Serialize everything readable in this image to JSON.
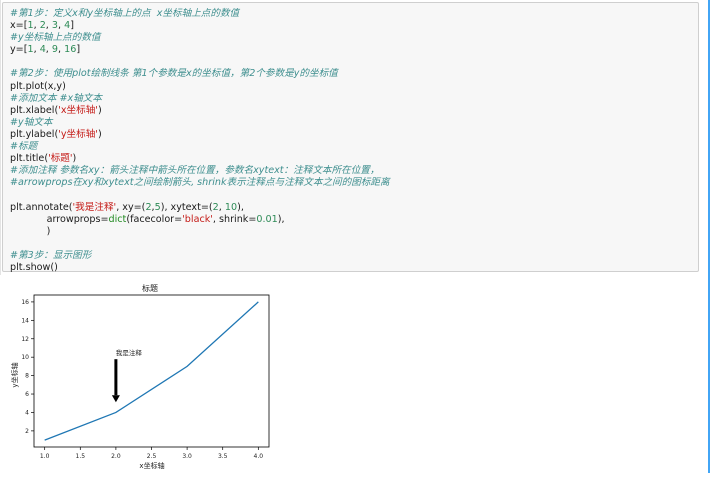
{
  "code_lines": [
    {
      "tokens": [
        {
          "t": "#第1步：定义x和y坐标轴上的点  x坐标轴上点的数值",
          "c": "c-cm"
        }
      ]
    },
    {
      "tokens": [
        {
          "t": "x=[",
          "c": ""
        },
        {
          "t": "1",
          "c": "c-num"
        },
        {
          "t": ", ",
          "c": ""
        },
        {
          "t": "2",
          "c": "c-num"
        },
        {
          "t": ", ",
          "c": ""
        },
        {
          "t": "3",
          "c": "c-num"
        },
        {
          "t": ", ",
          "c": ""
        },
        {
          "t": "4",
          "c": "c-num"
        },
        {
          "t": "]",
          "c": ""
        }
      ]
    },
    {
      "tokens": [
        {
          "t": "#y坐标轴上点的数值",
          "c": "c-cm"
        }
      ]
    },
    {
      "tokens": [
        {
          "t": "y=[",
          "c": ""
        },
        {
          "t": "1",
          "c": "c-num"
        },
        {
          "t": ", ",
          "c": ""
        },
        {
          "t": "4",
          "c": "c-num"
        },
        {
          "t": ", ",
          "c": ""
        },
        {
          "t": "9",
          "c": "c-num"
        },
        {
          "t": ", ",
          "c": ""
        },
        {
          "t": "16",
          "c": "c-num"
        },
        {
          "t": "]",
          "c": ""
        }
      ]
    },
    {
      "tokens": [
        {
          "t": "",
          "c": ""
        }
      ]
    },
    {
      "tokens": [
        {
          "t": "#第2步：使用plot绘制线条 第1个参数是x的坐标值，第2个参数是y的坐标值",
          "c": "c-cm"
        }
      ]
    },
    {
      "tokens": [
        {
          "t": "plt.plot(x,y)",
          "c": ""
        }
      ]
    },
    {
      "tokens": [
        {
          "t": "#添加文本 #x轴文本",
          "c": "c-cm"
        }
      ]
    },
    {
      "tokens": [
        {
          "t": "plt.xlabel(",
          "c": ""
        },
        {
          "t": "'x坐标轴'",
          "c": "c-str"
        },
        {
          "t": ")",
          "c": ""
        }
      ]
    },
    {
      "tokens": [
        {
          "t": "#y轴文本",
          "c": "c-cm"
        }
      ]
    },
    {
      "tokens": [
        {
          "t": "plt.ylabel(",
          "c": ""
        },
        {
          "t": "'y坐标轴'",
          "c": "c-str"
        },
        {
          "t": ")",
          "c": ""
        }
      ]
    },
    {
      "tokens": [
        {
          "t": "#标题",
          "c": "c-cm"
        }
      ]
    },
    {
      "tokens": [
        {
          "t": "plt.title(",
          "c": ""
        },
        {
          "t": "'标题'",
          "c": "c-str"
        },
        {
          "t": ")",
          "c": ""
        }
      ]
    },
    {
      "tokens": [
        {
          "t": "#添加注释 参数名xy：箭头注释中箭头所在位置，参数名xytext：注释文本所在位置，",
          "c": "c-cm"
        }
      ]
    },
    {
      "tokens": [
        {
          "t": "#arrowprops在xy和xytext之间绘制箭头, shrink表示注释点与注释文本之间的图标距离",
          "c": "c-cm"
        }
      ]
    },
    {
      "tokens": [
        {
          "t": "",
          "c": ""
        }
      ]
    },
    {
      "tokens": [
        {
          "t": "plt.annotate(",
          "c": ""
        },
        {
          "t": "'我是注释'",
          "c": "c-str"
        },
        {
          "t": ", xy=(",
          "c": ""
        },
        {
          "t": "2",
          "c": "c-num"
        },
        {
          "t": ",",
          "c": ""
        },
        {
          "t": "5",
          "c": "c-num"
        },
        {
          "t": "), xytext=(",
          "c": ""
        },
        {
          "t": "2",
          "c": "c-num"
        },
        {
          "t": ", ",
          "c": ""
        },
        {
          "t": "10",
          "c": "c-num"
        },
        {
          "t": "),",
          "c": ""
        }
      ]
    },
    {
      "tokens": [
        {
          "t": "            arrowprops=",
          "c": ""
        },
        {
          "t": "dict",
          "c": "c-fn"
        },
        {
          "t": "(facecolor=",
          "c": ""
        },
        {
          "t": "'black'",
          "c": "c-str"
        },
        {
          "t": ", shrink=",
          "c": ""
        },
        {
          "t": "0.01",
          "c": "c-num"
        },
        {
          "t": "),",
          "c": ""
        }
      ]
    },
    {
      "tokens": [
        {
          "t": "            )",
          "c": ""
        }
      ]
    },
    {
      "tokens": [
        {
          "t": "",
          "c": ""
        }
      ]
    },
    {
      "tokens": [
        {
          "t": "#第3步：显示图形",
          "c": "c-cm"
        }
      ]
    },
    {
      "tokens": [
        {
          "t": "plt.show()",
          "c": ""
        }
      ]
    }
  ],
  "chart_data": {
    "type": "line",
    "title": "标题",
    "xlabel": "x坐标轴",
    "ylabel": "y坐标轴",
    "x": [
      1,
      2,
      3,
      4
    ],
    "series": [
      {
        "values": [
          1,
          4,
          9,
          16
        ],
        "color": "#1f77b4"
      }
    ],
    "xlim": [
      0.85,
      4.15
    ],
    "ylim": [
      0.25,
      16.75
    ],
    "xticks": [
      "1.0",
      "1.5",
      "2.0",
      "2.5",
      "3.0",
      "3.5",
      "4.0"
    ],
    "xtick_values": [
      1.0,
      1.5,
      2.0,
      2.5,
      3.0,
      3.5,
      4.0
    ],
    "yticks": [
      "2",
      "4",
      "6",
      "8",
      "10",
      "12",
      "14",
      "16"
    ],
    "ytick_values": [
      2,
      4,
      6,
      8,
      10,
      12,
      14,
      16
    ],
    "annotation": {
      "text": "我是注释",
      "xy": [
        2,
        5
      ],
      "xytext": [
        2,
        10
      ],
      "arrow_color": "black"
    },
    "grid": false
  }
}
